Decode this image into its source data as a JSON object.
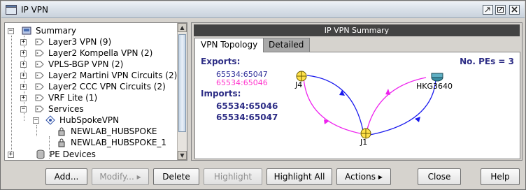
{
  "window": {
    "title": "IP VPN"
  },
  "tree": {
    "root": {
      "label": "Summary"
    },
    "items": [
      {
        "label": "Layer3 VPN (9)"
      },
      {
        "label": "Layer2 Kompella VPN (2)"
      },
      {
        "label": "VPLS-BGP VPN (2)"
      },
      {
        "label": "Layer2 Martini VPN Circuits (2)"
      },
      {
        "label": "Layer2 CCC VPN Circuits (2)"
      },
      {
        "label": "VRF Lite (1)"
      },
      {
        "label": "Services"
      }
    ],
    "service": {
      "label": "HubSpokeVPN"
    },
    "service_children": [
      {
        "label": "NEWLAB_HUBSPOKE"
      },
      {
        "label": "NEWLAB_HUBSPOKE_1"
      }
    ],
    "pe_devices": {
      "label": "PE Devices"
    }
  },
  "summary": {
    "header": "IP VPN Summary",
    "tabs": [
      {
        "label": "VPN Topology"
      },
      {
        "label": "Detailed"
      }
    ],
    "exports_label": "Exports:",
    "exports": [
      "65534:65047",
      "65534:65046"
    ],
    "imports_label": "Imports:",
    "imports": [
      "65534:65046",
      "65534:65047"
    ],
    "pes_count": "No. PEs = 3",
    "nodes": {
      "j4": "J4",
      "hkg": "HKG3640",
      "j1": "J1"
    },
    "colors": {
      "export_1": "#2f2f9a",
      "export_2": "#ff33cc",
      "blue_link": "#1a1aee",
      "pink_link": "#ee22ee"
    }
  },
  "buttons": {
    "add": "Add...",
    "modify": "Modify...",
    "delete": "Delete",
    "highlight": "Highlight",
    "highlight_all": "Highlight All",
    "actions": "Actions",
    "close": "Close",
    "help": "Help"
  }
}
